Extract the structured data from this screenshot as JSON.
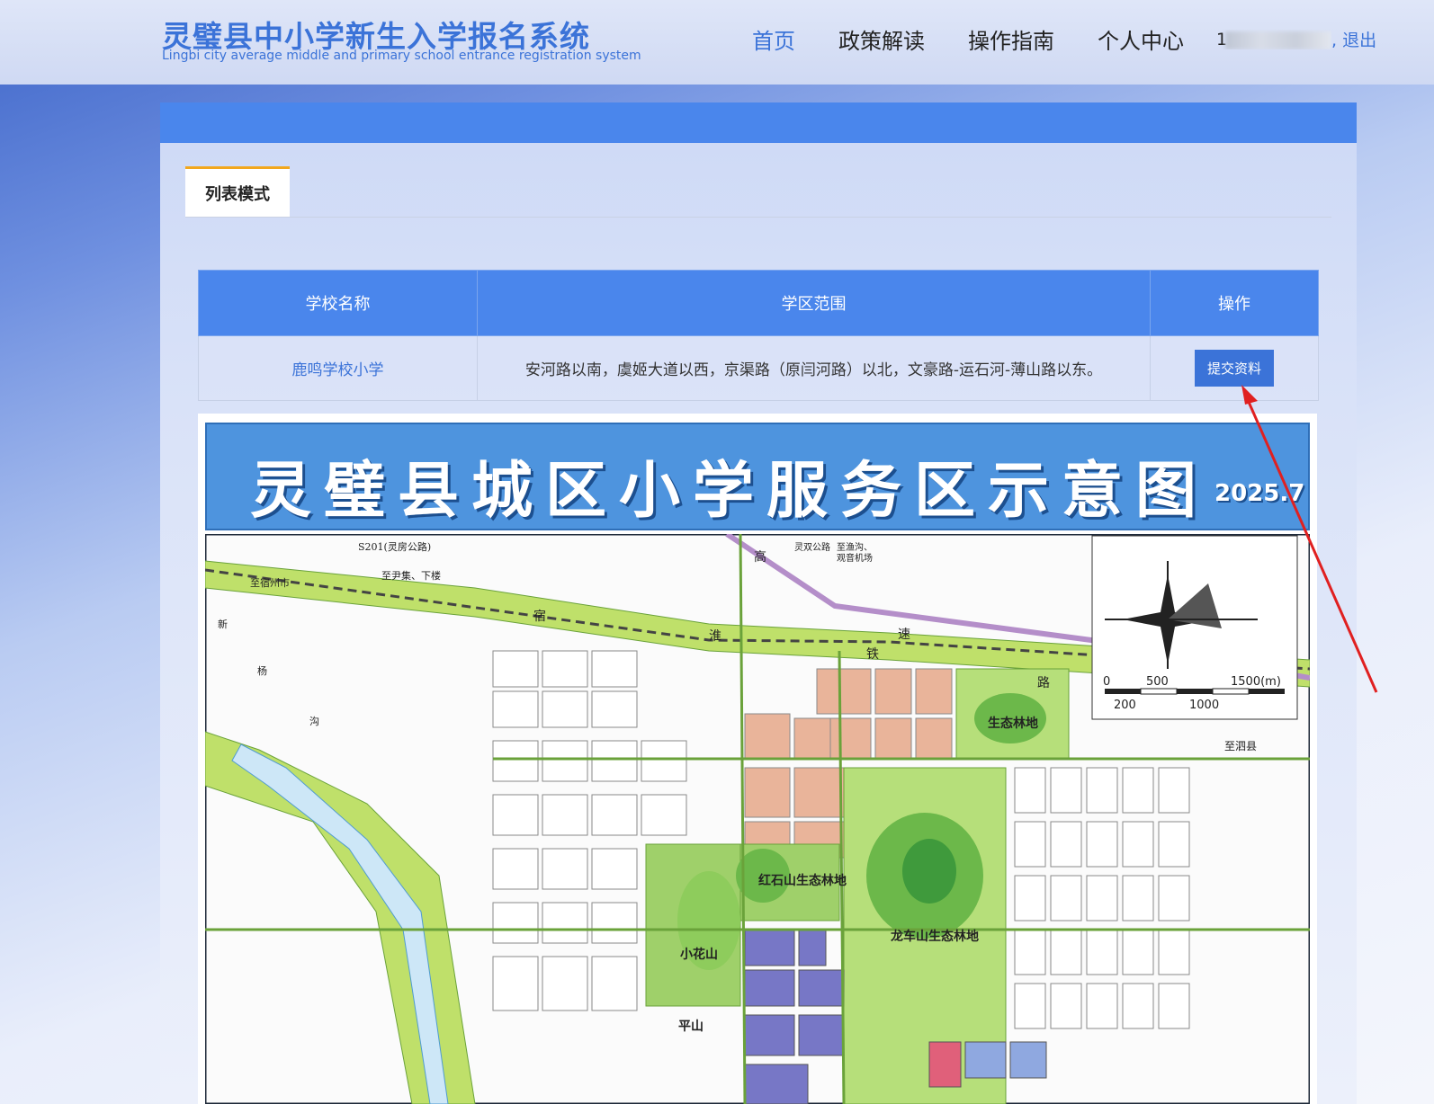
{
  "header": {
    "title": "灵璧县中小学新生入学报名系统",
    "subtitle": "Lingbi city average middle and primary school entrance registration system",
    "nav": [
      {
        "label": "首页"
      },
      {
        "label": "政策解读"
      },
      {
        "label": "操作指南"
      },
      {
        "label": "个人中心"
      }
    ],
    "user_name": "1",
    "logout_label": ", 退出"
  },
  "tabs": [
    {
      "label": "列表模式"
    }
  ],
  "table": {
    "headers": [
      "学校名称",
      "学区范围",
      "操作"
    ],
    "rows": [
      {
        "school": "鹿鸣学校小学",
        "district": "安河路以南，虞姬大道以西，京渠路（原闫河路）以北，文豪路-运石河-薄山路以东。",
        "action": "提交资料"
      }
    ]
  },
  "map": {
    "title": "灵璧县城区小学服务区示意图",
    "date": "2025.7",
    "labels": {
      "s201": "S201(灵房公路)",
      "to_yinji": "至尹集、下楼",
      "to_suzhou": "至宿州市",
      "lingshuang": "灵双公路",
      "to_yugou": "至渔沟、",
      "guanyin_airport": "观音机场",
      "high_speed_rail": [
        "宿",
        "淮",
        "高",
        "速",
        "铁",
        "路"
      ],
      "eco_forest": "生态林地",
      "hongshishan": "红石山生态林地",
      "longcheshan": "龙车山生态林地",
      "xiaohuashan": "小花山",
      "pingshan": "平山",
      "to_sixian": "至泗县",
      "xinbiangou": [
        "新",
        "杨",
        "沟"
      ]
    },
    "scale": {
      "top": [
        "0",
        "500",
        "1500(m)"
      ],
      "bottom": [
        "200",
        "1000"
      ]
    }
  },
  "colors": {
    "accent": "#3b73d8",
    "header_bar": "#4a86ec",
    "tab_accent": "#f2a71c",
    "map_title_bg": "#4e94de"
  }
}
